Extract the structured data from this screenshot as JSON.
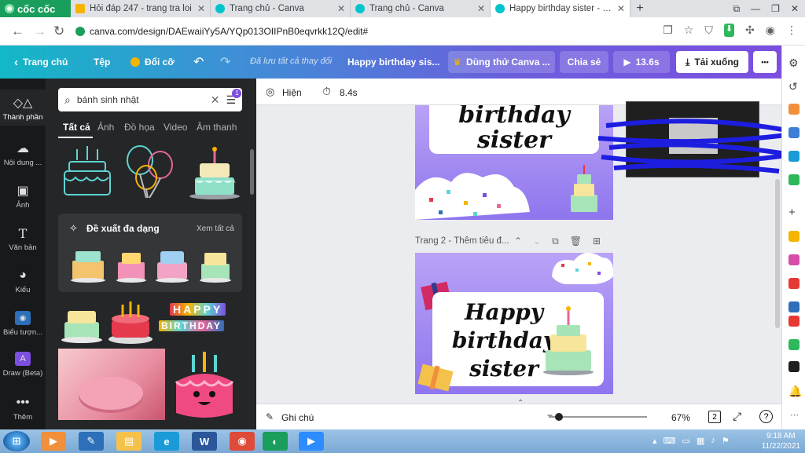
{
  "browser": {
    "brand": "cốc cốc",
    "tabs": [
      {
        "title": "Hỏi đáp 247 - trang tra loi",
        "favicon_color": "#f6b400"
      },
      {
        "title": "Trang chủ - Canva",
        "favicon_color": "#00c4cc"
      },
      {
        "title": "Trang chủ - Canva",
        "favicon_color": "#00c4cc"
      },
      {
        "title": "Happy birthday sister - Logo",
        "favicon_color": "#00c4cc",
        "active": true
      }
    ],
    "new_tab": "+",
    "url": "canva.com/design/DAEwaiiYy5A/YQp013OIIPnB0eqvrkk12Q/edit#"
  },
  "canva_header": {
    "home": "Trang chủ",
    "file": "Tệp",
    "resize": "Đổi cỡ",
    "saved_status": "Đã lưu tất cả thay đổi",
    "design_title": "Happy birthday sis...",
    "try_pro": "Dùng thử Canva ...",
    "share": "Chia sẻ",
    "play_time": "13.6s",
    "download": "Tải xuống",
    "more": "•••"
  },
  "rail": {
    "items": [
      {
        "label": "Thành phần",
        "icon": "elements-icon",
        "active": true
      },
      {
        "label": "Nội dung ...",
        "icon": "upload-icon"
      },
      {
        "label": "Ảnh",
        "icon": "photo-icon"
      },
      {
        "label": "Văn bản",
        "icon": "text-icon"
      },
      {
        "label": "Kiểu",
        "icon": "styles-icon"
      },
      {
        "label": "Biểu tượn...",
        "icon": "logo-icon"
      },
      {
        "label": "Draw (Beta)",
        "icon": "draw-icon"
      },
      {
        "label": "Thêm",
        "icon": "more-icon"
      }
    ]
  },
  "panel": {
    "search_value": "bánh sinh nhật",
    "filter_badge": "1",
    "tabs": [
      "Tất cả",
      "Ảnh",
      "Đồ họa",
      "Video",
      "Âm thanh"
    ],
    "suggest_title": "Đề xuất đa dạng",
    "see_all": "Xem tất cả",
    "happy_label": "HAPPY",
    "birthday_label": "BIRTHDAY"
  },
  "editor": {
    "show_label": "Hiện",
    "duration": "8.4s",
    "page1_text_line1": "birthday",
    "page1_text_line2": "sister",
    "page2_label": "Trang 2 - Thêm tiêu đ...",
    "page2_text_line1": "Happy",
    "page2_text_line2": "birthday",
    "page2_text_line3": "sister",
    "notes": "Ghi chú",
    "zoom": "67%",
    "page_count": "2",
    "help": "?"
  },
  "colors": {
    "canva_gradient_start": "#13b8c6",
    "canva_gradient_end": "#7b4fe0",
    "page_purple": "#8e75ee",
    "rail_bg": "#18191b",
    "panel_bg": "#252627"
  },
  "taskbar": {
    "time": "9:18 AM",
    "date": "11/22/2021"
  }
}
